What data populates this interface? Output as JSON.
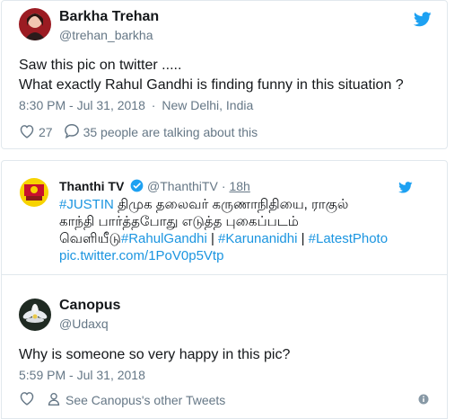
{
  "colors": {
    "brand": "#1da1f2",
    "link": "#1b95e0",
    "muted": "#657786",
    "text": "#14171a",
    "border": "#e1e8ed"
  },
  "tweet1": {
    "name": "Barkha Trehan",
    "handle": "@trehan_barkha",
    "line1": "Saw this pic on twitter .....",
    "line2": "What exactly Rahul Gandhi is finding funny in this situation ?",
    "time": "8:30 PM - Jul 31, 2018",
    "separator": "·",
    "location": "New Delhi, India",
    "likes": "27",
    "talking": "35 people are talking about this",
    "icons": {
      "bird": "twitter-bird-icon",
      "heart": "heart-icon",
      "reply": "reply-bubble-icon"
    }
  },
  "quoted": {
    "name": "Thanthi TV",
    "handle": "@ThanthiTV",
    "separator": "·",
    "age": "18h",
    "line1_tag": "#JUSTIN",
    "line1_rest": "திமுக தலைவர் கருணாநிதியை, ராகுல்",
    "line2": "காந்தி பார்த்தபோது எடுத்த புகைப்படம்",
    "line3_prefix": "வெளியீடு",
    "tag_rahul": "#RahulGandhi",
    "pipe": " | ",
    "tag_karunanidhi": "#Karunanidhi",
    "tag_latest": "#LatestPhoto",
    "pic_link": "pic.twitter.com/1PoV0p5Vtp",
    "icons": {
      "verified": "verified-badge-icon",
      "bird": "twitter-bird-icon"
    }
  },
  "tweet2": {
    "name": "Canopus",
    "handle": "@Udaxq",
    "text": "Why is someone so very happy in this pic?",
    "time": "5:59 PM - Jul 31, 2018",
    "other_tweets": "See Canopus's other Tweets",
    "icons": {
      "heart": "heart-icon",
      "person": "person-icon",
      "info": "info-icon"
    }
  }
}
